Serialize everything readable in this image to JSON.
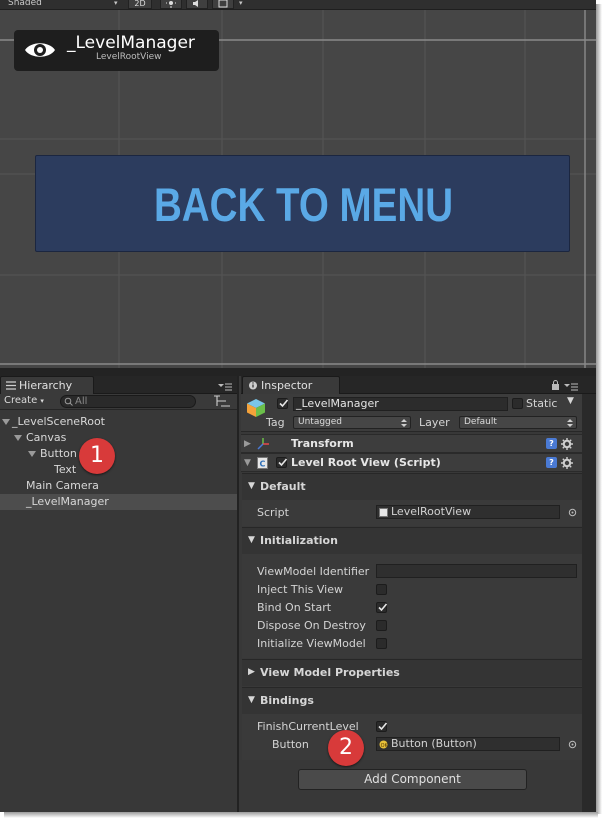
{
  "scene": {
    "toolbar": {
      "shading_mode": "Shaded",
      "mode_2d": "2D"
    },
    "selected_object": {
      "name": "_LevelManager",
      "view_type": "LevelRootView"
    },
    "button_text": "BACK TO MENU",
    "button_text_color": "#5aa9e6",
    "button_bg_color": "#2c3c5e"
  },
  "hierarchy": {
    "tab_label": "Hierarchy",
    "create_label": "Create",
    "search_placeholder": "All",
    "items": [
      {
        "label": "_LevelSceneRoot"
      },
      {
        "label": "Canvas"
      },
      {
        "label": "Button"
      },
      {
        "label": "Text"
      },
      {
        "label": "Main Camera"
      },
      {
        "label": "_LevelManager"
      }
    ],
    "marker": "1"
  },
  "inspector": {
    "tab_label": "Inspector",
    "object_name": "_LevelManager",
    "static_label": "Static",
    "tag_label": "Tag",
    "tag_value": "Untagged",
    "layer_label": "Layer",
    "layer_value": "Default",
    "transform_label": "Transform",
    "component_label": "Level Root View (Script)",
    "sections": {
      "default": {
        "title": "Default",
        "script_label": "Script",
        "script_value": "LevelRootView"
      },
      "initialization": {
        "title": "Initialization",
        "props": [
          {
            "label": "ViewModel Identifier"
          },
          {
            "label": "Inject This View",
            "checked": false
          },
          {
            "label": "Bind On Start",
            "checked": true
          },
          {
            "label": "Dispose On Destroy",
            "checked": false
          },
          {
            "label": "Initialize ViewModel",
            "checked": false
          }
        ]
      },
      "view_model_properties": {
        "title": "View Model Properties"
      },
      "bindings": {
        "title": "Bindings",
        "finish_label": "FinishCurrentLevel",
        "finish_checked": true,
        "button_label": "Button",
        "button_value": "Button (Button)"
      }
    },
    "add_component": "Add Component",
    "marker": "2",
    "marker_color": "#d83a3a"
  }
}
